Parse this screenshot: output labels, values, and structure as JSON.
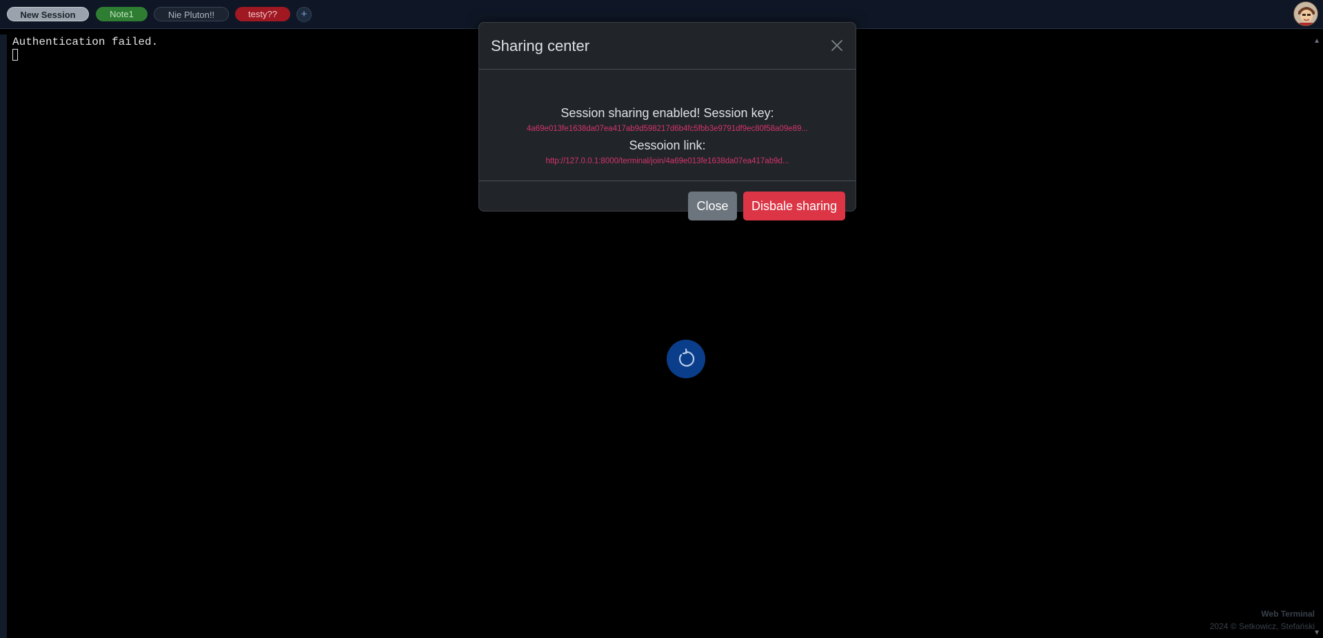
{
  "tabs": [
    {
      "label": "New Session"
    },
    {
      "label": "Note1"
    },
    {
      "label": "Nie Pluton!!"
    },
    {
      "label": "testy??"
    }
  ],
  "add_tab_label": "+",
  "terminal": {
    "output_line": "Authentication failed."
  },
  "modal": {
    "title": "Sharing center",
    "enabled_text": "Session sharing enabled! Session key:",
    "session_key": "4a69e013fe1638da07ea417ab9d598217d6b4fc5fbb3e9791df9ec80f58a09e89...",
    "link_label": "Sessoion link:",
    "session_link": "http://127.0.0.1:8000/terminal/join/4a69e013fe1638da07ea417ab9d...",
    "close_button": "Close",
    "disable_button": "Disbale sharing"
  },
  "footer": {
    "app_name": "Web Terminal",
    "copyright": "2024 © Setkowicz, Stefański"
  },
  "colors": {
    "accent_danger": "#dc3545",
    "accent_secondary": "#6c757d",
    "key_text": "#d6336c",
    "spinner_bg": "#0b3e8a"
  },
  "icons": {
    "close": "close-icon",
    "add": "plus-icon",
    "spinner": "refresh-icon",
    "avatar": "avatar"
  }
}
